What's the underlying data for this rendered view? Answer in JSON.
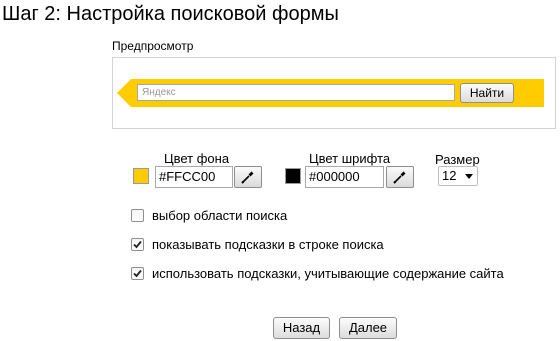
{
  "page_title": "Шаг 2: Настройка поисковой формы",
  "preview": {
    "label": "Предпросмотр",
    "input_placeholder": "Яндекс",
    "search_button": "Найти"
  },
  "colors": {
    "background_label": "Цвет фона",
    "background_value": "#FFCC00",
    "background_swatch": "#ffcc00",
    "font_label": "Цвет шрифта",
    "font_value": "#000000",
    "font_swatch": "#000000",
    "picker_icon": "eyedropper-icon"
  },
  "size": {
    "label": "Размер",
    "value": "12"
  },
  "options": [
    {
      "label": "выбор области поиска",
      "checked": false
    },
    {
      "label": "показывать подсказки в строке поиска",
      "checked": true
    },
    {
      "label": "использовать подсказки, учитывающие содержание сайта",
      "checked": true
    }
  ],
  "nav": {
    "back": "Назад",
    "next": "Далее"
  }
}
